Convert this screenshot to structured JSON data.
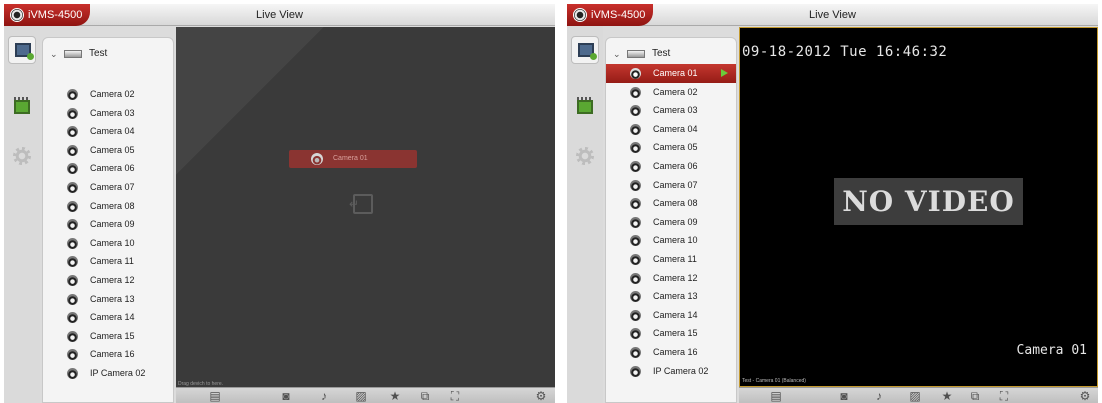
{
  "left": {
    "app_name": "iVMS-4500",
    "title": "Live View",
    "device": "Test",
    "cameras": [
      "Camera 02",
      "Camera 03",
      "Camera 04",
      "Camera 05",
      "Camera 06",
      "Camera 07",
      "Camera 08",
      "Camera 09",
      "Camera 10",
      "Camera 11",
      "Camera 12",
      "Camera 13",
      "Camera 14",
      "Camera 15",
      "Camera 16",
      "IP Camera 02"
    ],
    "drag_label": "Camera 01",
    "status": "Drag devich to here."
  },
  "right": {
    "app_name": "iVMS-4500",
    "title": "Live View",
    "device": "Test",
    "selected_camera": "Camera 01",
    "cameras": [
      "Camera 02",
      "Camera 03",
      "Camera 04",
      "Camera 05",
      "Camera 06",
      "Camera 07",
      "Camera 08",
      "Camera 09",
      "Camera 10",
      "Camera 11",
      "Camera 12",
      "Camera 13",
      "Camera 14",
      "Camera 15",
      "Camera 16",
      "IP Camera 02"
    ],
    "osd_datetime": "09-18-2012 Tue 16:46:32",
    "no_video": "NO VIDEO",
    "osd_camera": "Camera 01",
    "status": "Test - Camera 01 (Balanced)"
  },
  "toolbar": {
    "icons": [
      "layout-icon",
      "snapshot-icon",
      "talk-icon",
      "ptz-icon",
      "favorite-icon",
      "record-icon",
      "fullscreen-icon",
      "settings-icon"
    ],
    "glyphs": [
      "▤",
      "◙",
      "♪",
      "▨",
      "★",
      "⧉",
      "⛶",
      "⚙"
    ]
  }
}
